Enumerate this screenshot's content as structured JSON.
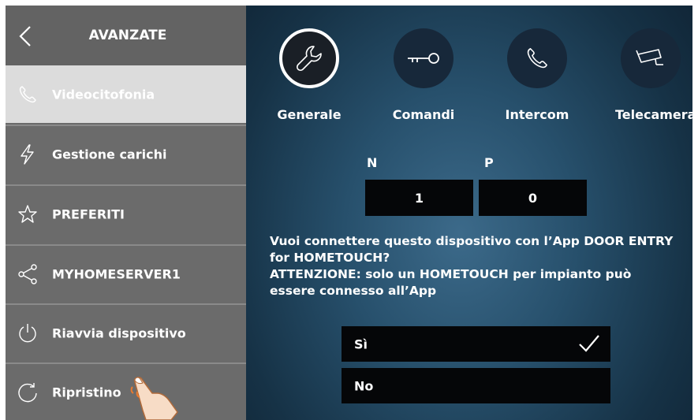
{
  "sidebar": {
    "title": "AVANZATE",
    "items": [
      {
        "label": "Videocitofonia",
        "icon": "phone-icon",
        "active": true
      },
      {
        "label": "Gestione carichi",
        "icon": "lightning-icon",
        "active": false
      },
      {
        "label": "PREFERITI",
        "icon": "star-icon",
        "active": false
      },
      {
        "label": "MYHOMESERVER1",
        "icon": "share-icon",
        "active": false
      },
      {
        "label": "Riavvia dispositivo",
        "icon": "power-icon",
        "active": false
      },
      {
        "label": "Ripristino",
        "icon": "reset-icon",
        "active": false
      }
    ]
  },
  "tabs": [
    {
      "label": "Generale",
      "icon": "wrench-icon",
      "active": true
    },
    {
      "label": "Comandi",
      "icon": "key-icon",
      "active": false
    },
    {
      "label": "Intercom",
      "icon": "phone-icon",
      "active": false
    },
    {
      "label": "Telecamera",
      "icon": "camera-icon",
      "active": false
    }
  ],
  "address": {
    "n_label": "N",
    "p_label": "P",
    "n_value": "1",
    "p_value": "0"
  },
  "question": {
    "line1": "Vuoi connettere questo dispositivo con l’App DOOR ENTRY for HOMETOUCH?",
    "line2": "ATTENZIONE: solo un HOMETOUCH per impianto può essere connesso all’App"
  },
  "options": [
    {
      "label": "Sì",
      "selected": true
    },
    {
      "label": "No",
      "selected": false
    }
  ],
  "colors": {
    "sidebar_bg": "#6b6b6b",
    "sidebar_active": "#dcdcdc",
    "main_bg": "#27506c",
    "box_bg": "#050608"
  }
}
